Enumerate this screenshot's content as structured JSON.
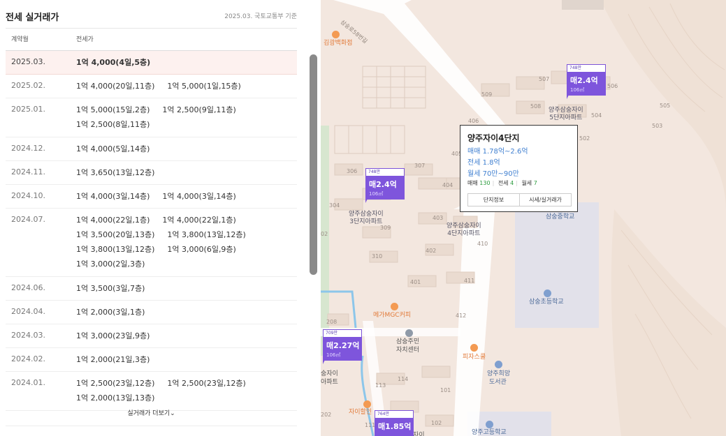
{
  "panel": {
    "title": "전세 실거래가",
    "source": "2025.03. 국토교통부 기준",
    "col_date": "계약월",
    "col_price": "전세가",
    "more_label": "실거래가 더보기⌄",
    "rows": [
      {
        "date": "2025.03.",
        "lines": [
          [
            "1억 4,000(4일,5층)"
          ]
        ],
        "highlight": true
      },
      {
        "date": "2025.02.",
        "lines": [
          [
            "1억 4,000(20일,11층)",
            "1억 5,000(1일,15층)"
          ]
        ]
      },
      {
        "date": "2025.01.",
        "lines": [
          [
            "1억 5,000(15일,2층)",
            "1억 2,500(9일,11층)"
          ],
          [
            "1억 2,500(8일,11층)"
          ]
        ]
      },
      {
        "date": "2024.12.",
        "lines": [
          [
            "1억 4,000(5일,14층)"
          ]
        ]
      },
      {
        "date": "2024.11.",
        "lines": [
          [
            "1억 3,650(13일,12층)"
          ]
        ]
      },
      {
        "date": "2024.10.",
        "lines": [
          [
            "1억 4,000(3일,14층)",
            "1억 4,000(3일,14층)"
          ]
        ]
      },
      {
        "date": "2024.07.",
        "lines": [
          [
            "1억 4,000(22일,1층)",
            "1억 4,000(22일,1층)"
          ],
          [
            "1억 3,500(20일,13층)",
            "1억 3,800(13일,12층)"
          ],
          [
            "1억 3,800(13일,12층)",
            "1억 3,000(6일,9층)"
          ],
          [
            "1억 3,000(2일,3층)"
          ]
        ]
      },
      {
        "date": "2024.06.",
        "lines": [
          [
            "1억 3,500(3일,7층)"
          ]
        ]
      },
      {
        "date": "2024.04.",
        "lines": [
          [
            "1억 2,000(3일,1층)"
          ]
        ]
      },
      {
        "date": "2024.03.",
        "lines": [
          [
            "1억 3,000(23일,9층)"
          ]
        ]
      },
      {
        "date": "2024.02.",
        "lines": [
          [
            "1억 2,000(21일,3층)"
          ]
        ]
      },
      {
        "date": "2024.01.",
        "lines": [
          [
            "1억 2,500(23일,12층)",
            "1억 2,500(23일,12층)"
          ],
          [
            "1억 2,000(13일,13층)"
          ]
        ]
      }
    ]
  },
  "map": {
    "road_label": "삼숭로58번길",
    "store_label": "김광백화점",
    "blocks": [
      "509",
      "507",
      "506",
      "505",
      "508",
      "504",
      "503",
      "406",
      "502",
      "405",
      "307",
      "306",
      "404",
      "304",
      "309",
      "403",
      "410",
      "402",
      "310",
      "401",
      "411",
      "412",
      "208",
      "113",
      "114",
      "101",
      "202",
      "111",
      "102",
      "02"
    ],
    "pois": {
      "cafe": "메가MGC커피",
      "center_1": "삼숭주민",
      "center_2": "자치센터",
      "pizza": "피자스쿨",
      "library_1": "양주희망",
      "library_2": "도서관",
      "school_elem": "삼숭초등학교",
      "school_high": "양주고등학교",
      "partial_school": "삼숭중학교",
      "mart": "자이할인",
      "partial_complex_1": "숭자이",
      "partial_complex_2": "아파트",
      "partial_complex_3": "자이"
    },
    "complexes": {
      "c5_1": "양주삼숭자이",
      "c5_2": "5단지아파트",
      "c3_1": "양주삼숭자이",
      "c3_2": "3단지아파트",
      "c4_1": "양주삼숭자이",
      "c4_2": "4단지아파트"
    },
    "markers": [
      {
        "tag": "748만",
        "price": "매2.4억",
        "area": "106㎡"
      },
      {
        "tag": "748만",
        "price": "매2.4억",
        "area": "106㎡"
      },
      {
        "tag": "709만",
        "price": "매2.27억",
        "area": "106㎡"
      },
      {
        "tag": "764만",
        "price": "매1.85억",
        "area": ""
      }
    ],
    "popup": {
      "name": "양주자이4단지",
      "sale": "매매 1.78억~2.6억",
      "jeonse": "전세 1.8억",
      "rent": "월세 70만~90만",
      "count_sale_label": "매매",
      "count_sale": "130",
      "count_jeonse_label": "전세",
      "count_jeonse": "4",
      "count_rent_label": "월세",
      "count_rent": "7",
      "btn_info": "단지정보",
      "btn_price": "시세/실거래가"
    }
  }
}
